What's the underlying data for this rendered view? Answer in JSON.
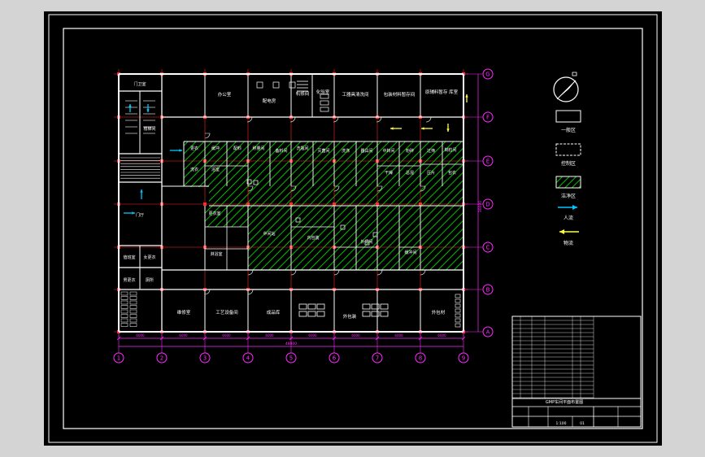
{
  "viewport": {
    "title": "",
    "background": "#d4d4d4",
    "paper": "#000000"
  },
  "colors": {
    "wall": "#ffffff",
    "grid": "#ff2a2a",
    "axis_bubble": "#ff2aff",
    "dim": "#ff2aff",
    "clean_area": "#00c000",
    "people_flow": "#00c8ff",
    "material_flow": "#ffff40",
    "frame": "#ffffff"
  },
  "axes": {
    "columns": [
      "1",
      "2",
      "3",
      "4",
      "5",
      "6",
      "7",
      "8",
      "9"
    ],
    "rows": [
      "G",
      "F",
      "E",
      "D",
      "C",
      "B",
      "A"
    ],
    "bay_dimensions": [
      "6000",
      "6000",
      "6000",
      "6000",
      "6000",
      "6000",
      "6000",
      "6000"
    ],
    "overall_width": "48000",
    "side_dimension": "30000"
  },
  "rooms": {
    "top": [
      "办公室",
      "配电房",
      "机修间",
      "化验室",
      "工器具清洗间",
      "包装材料暂存间",
      "原辅料暂存 库室"
    ],
    "clean": [
      "更衣",
      "缓冲",
      "洗衣",
      "浴室",
      "配料",
      "称量间",
      "备料间",
      "洗瓶间",
      "灭菌间",
      "洗涤",
      "器具间",
      "中转间",
      "粉碎",
      "过筛",
      "制粒间",
      "干燥",
      "总混",
      "压片",
      "包衣",
      "中间站",
      "内包装",
      "外清间",
      "缓冲间"
    ],
    "left": [
      "门卫室",
      "门厅",
      "楼梯间",
      "值班室",
      "女更衣",
      "男更衣",
      "厕所",
      "更衣室",
      "淋浴室"
    ],
    "bottom": [
      "维修室",
      "工艺设备间",
      "成品库",
      "外包装",
      "外包材"
    ]
  },
  "legend": {
    "items": [
      "一般区",
      "控制区",
      "洁净区",
      "人流",
      "物流"
    ]
  },
  "title_block": {
    "drawing_title": "GMP车间平面布置图",
    "scale": "1:100",
    "sheet": "01"
  }
}
